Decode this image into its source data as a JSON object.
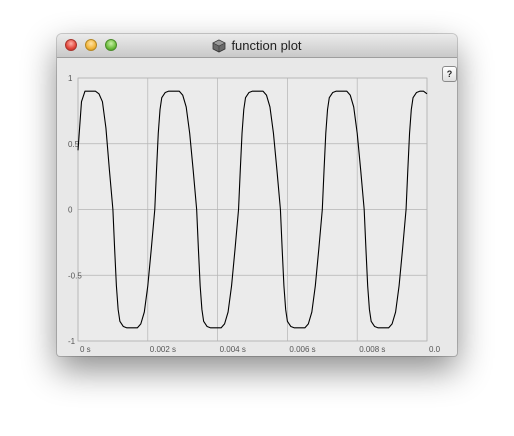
{
  "window": {
    "title": "function plot",
    "help_label": "?"
  },
  "colors": {
    "plot_background": "#ebebeb",
    "grid": "#b4b4b4",
    "curve": "#000000"
  },
  "chart_data": {
    "type": "line",
    "title": "",
    "xlabel": "",
    "ylabel": "",
    "xlim": [
      0,
      0.01
    ],
    "ylim": [
      -1,
      1
    ],
    "grid": true,
    "legend": "none",
    "x_ticks": [
      {
        "value": 0,
        "label": "0 s"
      },
      {
        "value": 0.002,
        "label": "0.002 s"
      },
      {
        "value": 0.004,
        "label": "0.004 s"
      },
      {
        "value": 0.006,
        "label": "0.006 s"
      },
      {
        "value": 0.008,
        "label": "0.008 s"
      },
      {
        "value": 0.01,
        "label": "0.0"
      }
    ],
    "y_ticks": [
      {
        "value": 1,
        "label": "1"
      },
      {
        "value": 0.5,
        "label": "0.5"
      },
      {
        "value": 0,
        "label": "0"
      },
      {
        "value": -0.5,
        "label": "-0.5"
      },
      {
        "value": -1,
        "label": "-1"
      }
    ],
    "series": [
      {
        "x": [
          0,
          0.0001,
          0.0002,
          0.0003,
          0.0004,
          0.0005,
          0.0006,
          0.0007,
          0.0008,
          0.0009,
          0.001,
          0.00105,
          0.0011,
          0.00115,
          0.0012,
          0.0013,
          0.0014,
          0.0015,
          0.0016,
          0.0017,
          0.0018,
          0.0019,
          0.002,
          0.0021,
          0.0022,
          0.00225,
          0.0023,
          0.00235,
          0.0024,
          0.0025,
          0.0026,
          0.0027,
          0.0028,
          0.0029,
          0.003,
          0.0031,
          0.0032,
          0.0033,
          0.0034,
          0.00345,
          0.0035,
          0.00355,
          0.0036,
          0.0037,
          0.0038,
          0.0039,
          0.004,
          0.0041,
          0.0042,
          0.0043,
          0.0044,
          0.0045,
          0.0046,
          0.00465,
          0.0047,
          0.00475,
          0.0048,
          0.0049,
          0.005,
          0.0051,
          0.0052,
          0.0053,
          0.0054,
          0.0055,
          0.0056,
          0.0057,
          0.0058,
          0.00585,
          0.0059,
          0.00595,
          0.006,
          0.0061,
          0.0062,
          0.0063,
          0.0064,
          0.0065,
          0.0066,
          0.0067,
          0.0068,
          0.0069,
          0.007,
          0.00705,
          0.0071,
          0.00715,
          0.0072,
          0.0073,
          0.0074,
          0.0075,
          0.0076,
          0.0077,
          0.0078,
          0.0079,
          0.008,
          0.0081,
          0.0082,
          0.00825,
          0.0083,
          0.00835,
          0.0084,
          0.0085,
          0.0086,
          0.0087,
          0.0088,
          0.0089,
          0.009,
          0.0091,
          0.0092,
          0.0093,
          0.0094,
          0.00945,
          0.0095,
          0.00955,
          0.0096,
          0.0097,
          0.0098,
          0.0099,
          0.01
        ],
        "y": [
          0.45,
          0.82,
          0.9,
          0.9,
          0.9,
          0.9,
          0.88,
          0.82,
          0.62,
          0.3,
          0.0,
          -0.3,
          -0.58,
          -0.76,
          -0.85,
          -0.89,
          -0.9,
          -0.9,
          -0.9,
          -0.9,
          -0.87,
          -0.78,
          -0.58,
          -0.3,
          0.0,
          0.3,
          0.58,
          0.76,
          0.85,
          0.89,
          0.9,
          0.9,
          0.9,
          0.9,
          0.87,
          0.78,
          0.58,
          0.3,
          0.0,
          -0.3,
          -0.58,
          -0.76,
          -0.85,
          -0.89,
          -0.9,
          -0.9,
          -0.9,
          -0.9,
          -0.87,
          -0.78,
          -0.58,
          -0.3,
          0.0,
          0.3,
          0.58,
          0.76,
          0.85,
          0.89,
          0.9,
          0.9,
          0.9,
          0.9,
          0.87,
          0.78,
          0.58,
          0.3,
          0.0,
          -0.3,
          -0.58,
          -0.76,
          -0.85,
          -0.89,
          -0.9,
          -0.9,
          -0.9,
          -0.9,
          -0.87,
          -0.78,
          -0.58,
          -0.3,
          0.0,
          0.3,
          0.58,
          0.76,
          0.85,
          0.89,
          0.9,
          0.9,
          0.9,
          0.9,
          0.87,
          0.78,
          0.58,
          0.3,
          0.0,
          -0.3,
          -0.58,
          -0.76,
          -0.85,
          -0.89,
          -0.9,
          -0.9,
          -0.9,
          -0.9,
          -0.87,
          -0.78,
          -0.58,
          -0.3,
          0.0,
          0.3,
          0.58,
          0.76,
          0.85,
          0.89,
          0.9,
          0.9,
          0.88
        ]
      }
    ]
  }
}
